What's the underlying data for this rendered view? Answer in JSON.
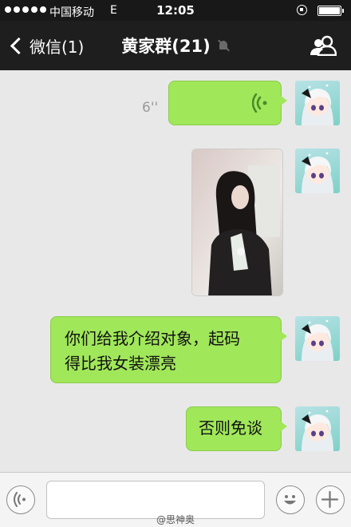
{
  "status_bar": {
    "carrier": "中国移动",
    "network": "E",
    "time": "12:05"
  },
  "nav": {
    "back_label": "微信(1)",
    "title": "黄家群(21)",
    "icons": [
      "back-chevron-icon",
      "mute-icon",
      "group-members-icon"
    ]
  },
  "messages": [
    {
      "type": "voice",
      "duration": "6''"
    },
    {
      "type": "image"
    },
    {
      "type": "text",
      "lines": [
        "你们给我介绍对象，起码",
        "得比我女装漂亮"
      ]
    },
    {
      "type": "text",
      "lines": [
        "否则免谈"
      ]
    }
  ],
  "input_bar": {
    "placeholder": "",
    "icons": [
      "voice-input-icon",
      "emoji-icon",
      "plus-icon"
    ]
  },
  "watermark": "@思神奥",
  "colors": {
    "bubble": "#a0e75a",
    "background": "#e8e8e8",
    "nav": "#1e1e1e"
  }
}
